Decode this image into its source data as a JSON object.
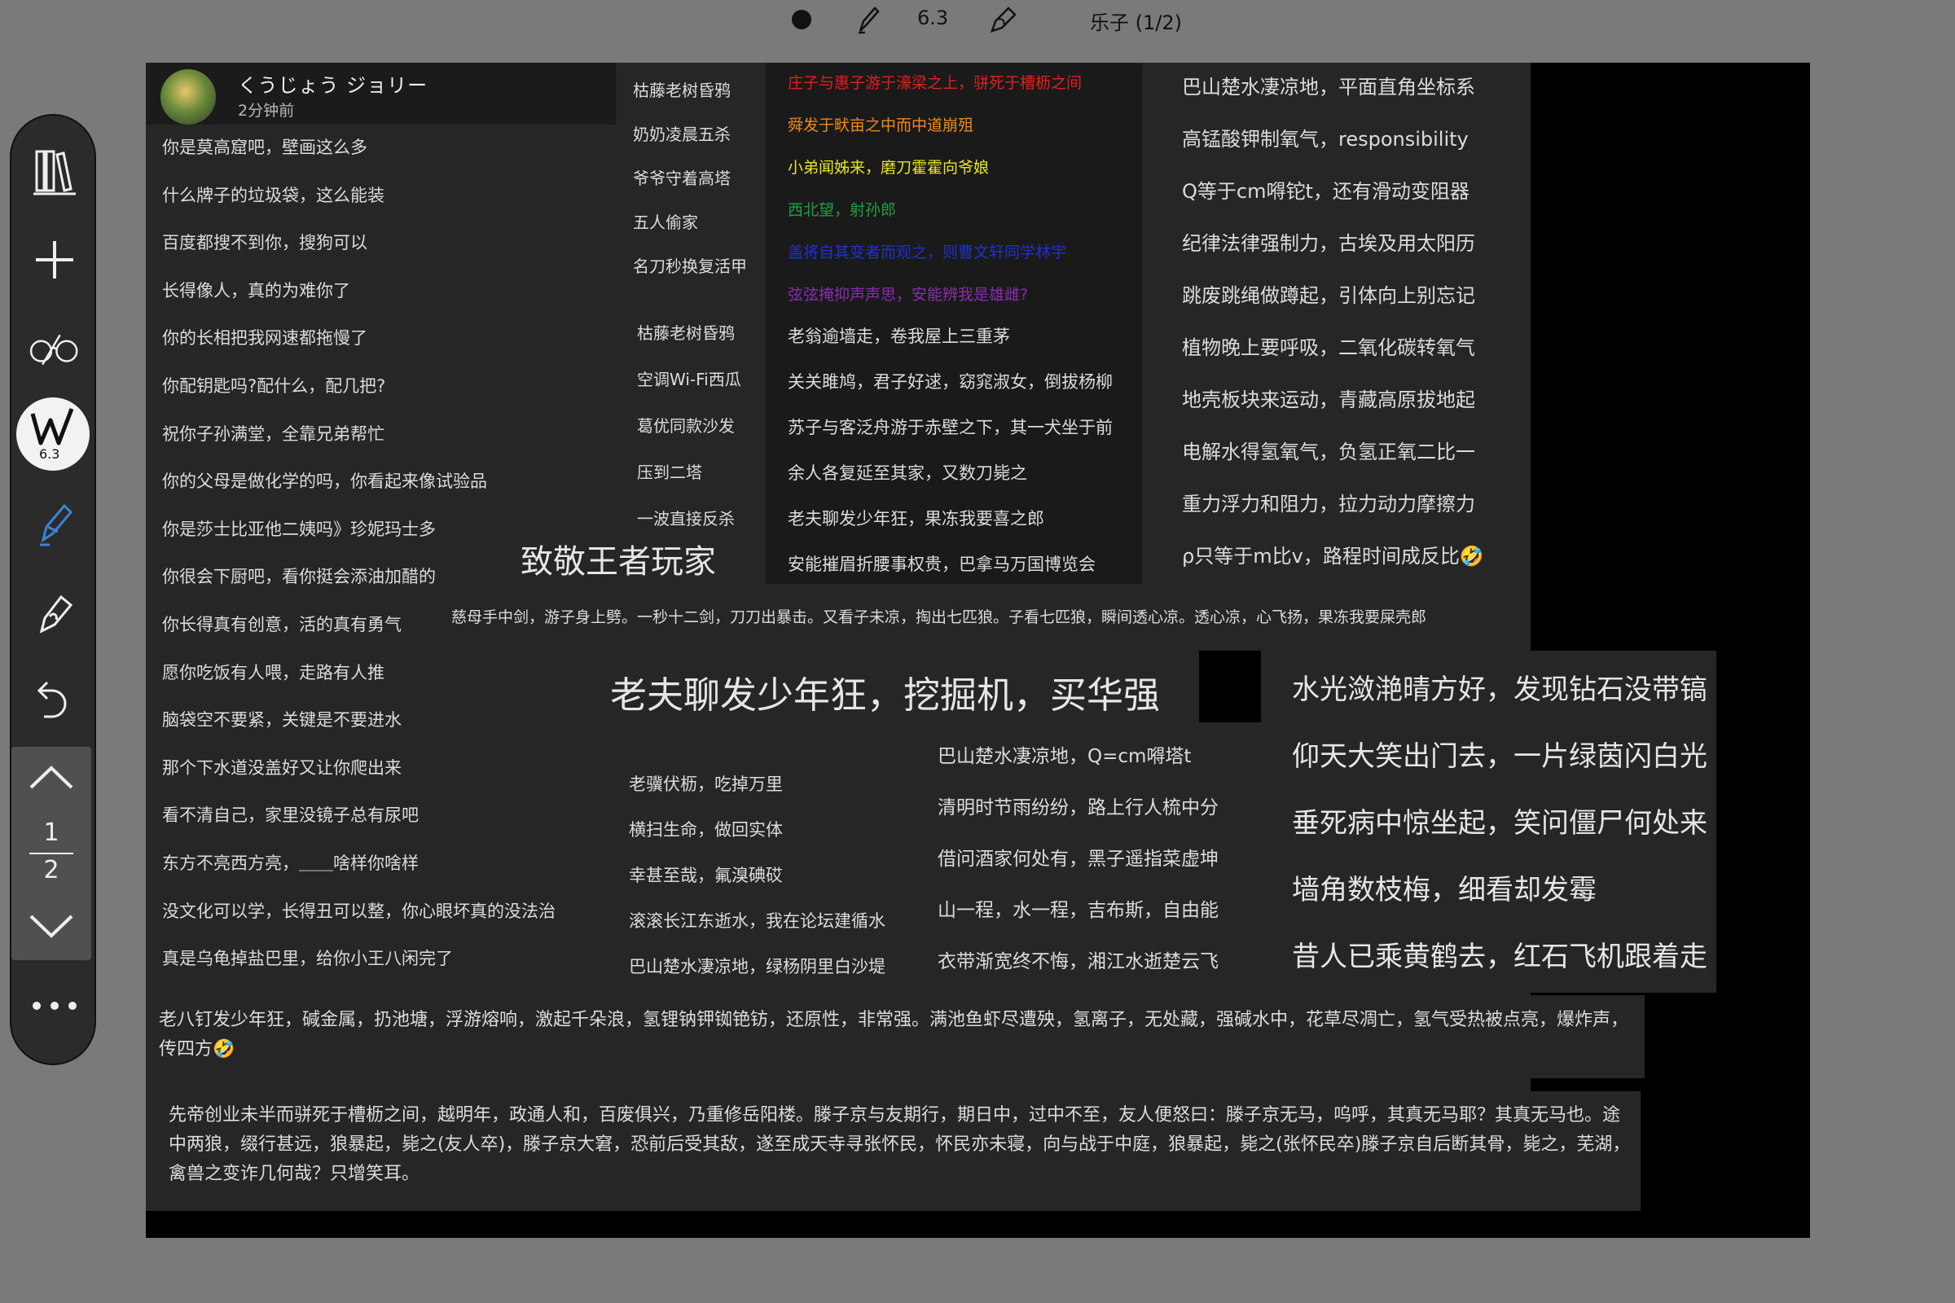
{
  "toolbar": {
    "pen_size": "6.3",
    "page_title": "乐子 (1/2)",
    "icons": [
      "dot-icon",
      "pen-icon",
      "highlighter-icon"
    ]
  },
  "sidebar": {
    "icons": [
      "library-icon",
      "add-icon",
      "glasses-icon",
      "writer-icon",
      "pen-icon",
      "lasso-icon",
      "undo-icon",
      "more-icon"
    ],
    "badge_value": "6.3",
    "page_current": "1",
    "page_total": "2"
  },
  "chat": {
    "username": "くうじょう ジョリー",
    "time": "2分钟前"
  },
  "col1": [
    "你是莫高窟吧，壁画这么多",
    "什么牌子的垃圾袋，这么能装",
    "百度都搜不到你，搜狗可以",
    "长得像人，真的为难你了",
    "你的长相把我网速都拖慢了",
    "你配钥匙吗?配什么，配几把?",
    "祝你子孙满堂，全靠兄弟帮忙",
    "你的父母是做化学的吗，你看起来像试验品",
    "你是莎士比亚他二姨吗》珍妮玛士多",
    "你很会下厨吧，看你挺会添油加醋的",
    "你长得真有创意，活的真有勇气",
    "愿你吃饭有人喂，走路有人推",
    "脑袋空不要紧，关键是不要进水",
    "那个下水道没盖好又让你爬出来",
    "看不清自己，家里没镜子总有尿吧",
    "东方不亮西方亮，＿＿啥样你啥样",
    "没文化可以学，长得丑可以整，你心眼坏真的没法治",
    "真是乌龟掉盐巴里，给你小王八闲完了"
  ],
  "col2": [
    "枯藤老树昏鸦",
    "奶奶凌晨五杀",
    "爷爷守着高塔",
    "五人偷家",
    "名刀秒换复活甲",
    "枯藤老树昏鸦",
    "空调Wi-Fi西瓜",
    "葛优同款沙发",
    "压到二塔",
    "一波直接反杀"
  ],
  "col3_colored": [
    {
      "text": "庄子与惠子游于濠梁之上，骈死于槽枥之间",
      "color": "#e02020"
    },
    {
      "text": "舜发于畎亩之中而中道崩殂",
      "color": "#f08a1c"
    },
    {
      "text": "小弟闻姊来，磨刀霍霍向爷娘",
      "color": "#e6e61e"
    },
    {
      "text": "西北望，射孙郎",
      "color": "#20a040"
    },
    {
      "text": "盖将自其变者而观之，则曹文轩同学林宇",
      "color": "#2030d0"
    },
    {
      "text": "弦弦掩抑声声思，安能辨我是雄雌?",
      "color": "#8a2cb0"
    }
  ],
  "col3": [
    "老翁逾墙走，卷我屋上三重茅",
    "关关雎鸠，君子好逑，窈窕淑女，倒拔杨柳",
    "苏子与客泛舟游于赤壁之下，其一犬坐于前",
    "余人各复延至其家，又数刀毙之",
    "老夫聊发少年狂，果冻我要喜之郎",
    "安能摧眉折腰事权贵，巴拿马万国博览会"
  ],
  "col4": [
    "巴山楚水凄凉地，平面直角坐标系",
    "高锰酸钾制氧气，responsibility",
    "Q等于cm嘚铊t，还有滑动变阻器",
    "纪律法律强制力，古埃及用太阳历",
    "跳废跳绳做蹲起，引体向上别忘记",
    "植物晚上要呼吸，二氧化碳转氧气",
    "地壳板块来运动，青藏高原拔地起",
    "电解水得氢氧气，负氢正氧二比一",
    "重力浮力和阻力，拉力动力摩擦力",
    "ρ只等于m比v，路程时间成反比🤣"
  ],
  "heading1": "致敬王者玩家",
  "long_line": "慈母手中剑，游子身上劈。一秒十二剑，刀刀出暴击。又看子未凉，掏出七匹狼。子看七匹狼，瞬间透心凉。透心凉，心飞扬，果冻我要屎壳郎",
  "heading2": "老夫聊发少年狂，挖掘机，买华强",
  "col5": [
    "老骥伏枥，吃掉万里",
    "横扫生命，做回实体",
    "幸甚至哉，氟溴碘砹",
    "滚滚长江东逝水，我在论坛建循水",
    "巴山楚水凄凉地，绿杨阴里白沙堤"
  ],
  "col6": [
    "巴山楚水凄凉地，Q=cm嘚塔t",
    "清明时节雨纷纷，路上行人梳中分",
    "借问酒家何处有，黑子遥指菜虚坤",
    "山一程，水一程，吉布斯，自由能",
    "衣带渐宽终不悔，湘江水逝楚云飞"
  ],
  "col7": [
    "水光潋滟晴方好，发现钻石没带镐",
    "仰天大笑出门去，一片绿茵闪白光",
    "垂死病中惊坐起，笑问僵尸何处来",
    "墙角数枝梅，细看却发霉",
    "昔人已乘黄鹤去，红石飞机跟着走"
  ],
  "para1": "老八钉发少年狂，碱金属，扔池塘，浮游熔响，激起千朵浪，氢锂钠钾铷铯钫，还原性，非常强。满池鱼虾尽遭殃，氢离子，无处藏，强碱水中，花草尽凋亡，氢气受热被点亮，爆炸声，传四方🤣",
  "para2": "先帝创业未半而骈死于槽枥之间，越明年，政通人和，百废俱兴，乃重修岳阳楼。滕子京与友期行，期日中，过中不至，友人便怒曰：滕子京无马，呜呼，其真无马耶？其真无马也。途中两狼，缀行甚远，狼暴起，毙之(友人卒)，滕子京大窘，恐前后受其敌，遂至成天寺寻张怀民，怀民亦未寝，向与战于中庭，狼暴起，毙之(张怀民卒)滕子京自后断其骨，毙之，芜湖，禽兽之变诈几何哉？只增笑耳。"
}
